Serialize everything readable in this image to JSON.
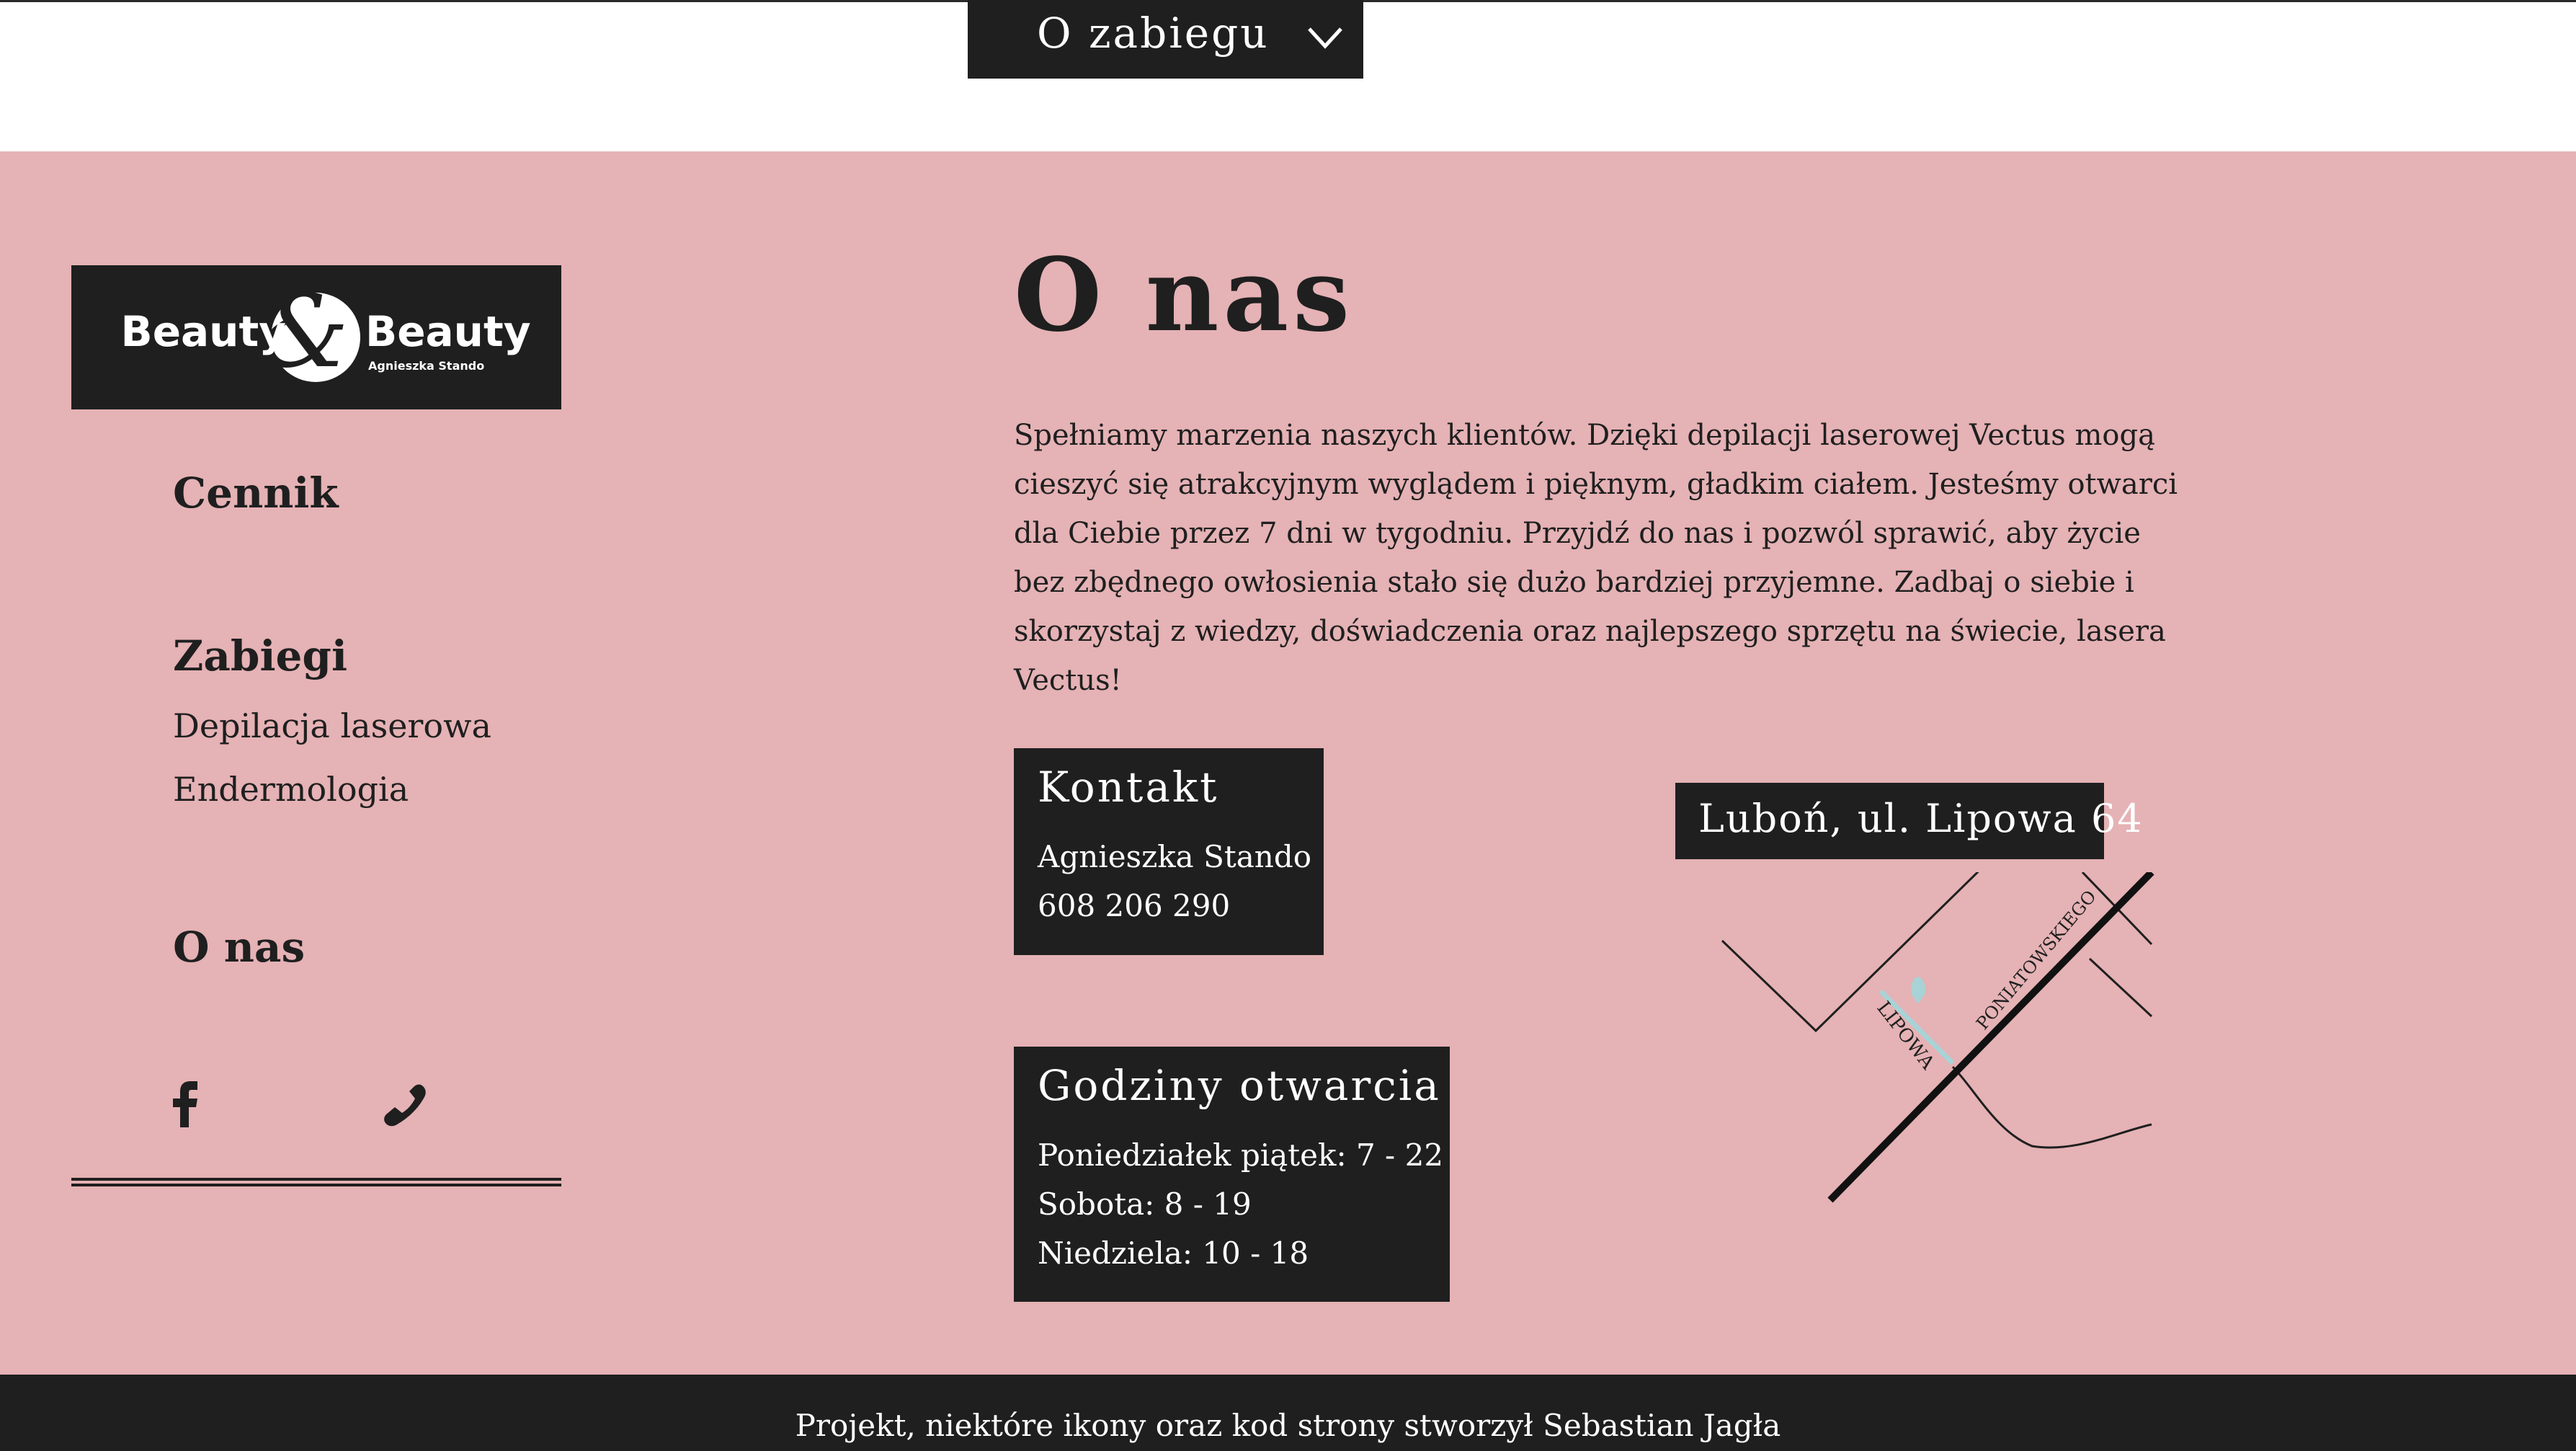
{
  "header": {
    "dropdown_label": "O zabiegu"
  },
  "logo": {
    "word_left": "Beauty",
    "word_right": "Beauty",
    "ampersand": "&",
    "owner": "Agnieszka Stando"
  },
  "sidebar": {
    "cennik": "Cennik",
    "zabiegi": "Zabiegi",
    "zabiegi_items": [
      "Depilacja laserowa",
      "Endermologia"
    ],
    "o_nas": "O nas",
    "icons": [
      "facebook-icon",
      "phone-icon"
    ]
  },
  "about": {
    "title": "O nas",
    "text": "Spełniamy marzenia naszych klientów. Dzięki depilacji laserowej Vectus mogą cieszyć się atrakcyjnym wyglądem i pięknym, gładkim ciałem. Jesteśmy otwarci dla Ciebie przez 7 dni w tygodniu. Przyjdź do nas i pozwól sprawić, aby życie bez zbędnego owłosienia stało się dużo bardziej przyjemne. Zadbaj o siebie i skorzystaj z wiedzy, doświadczenia oraz najlepszego sprzętu na świecie, lasera Vectus!"
  },
  "contact": {
    "title": "Kontakt",
    "name": "Agnieszka Stando",
    "phone": "608 206 290"
  },
  "hours": {
    "title": "Godziny otwarcia",
    "lines": [
      "Poniedziałek piątek: 7 - 22",
      "Sobota: 8 - 19",
      "Niedziela: 10 - 18"
    ]
  },
  "map": {
    "address": "Luboń, ul. Lipowa 64",
    "street_lipowa": "LIPOWA",
    "street_poniatowskiego": "PONIATOWSKIEGO",
    "pin_color": "#a8d3d6"
  },
  "footer": {
    "credit": "Projekt, niektóre ikony oraz kod strony stworzył Sebastian Jagła"
  },
  "colors": {
    "pink": "#e5b2b5",
    "dark": "#1f1f1f",
    "white": "#ffffff"
  }
}
